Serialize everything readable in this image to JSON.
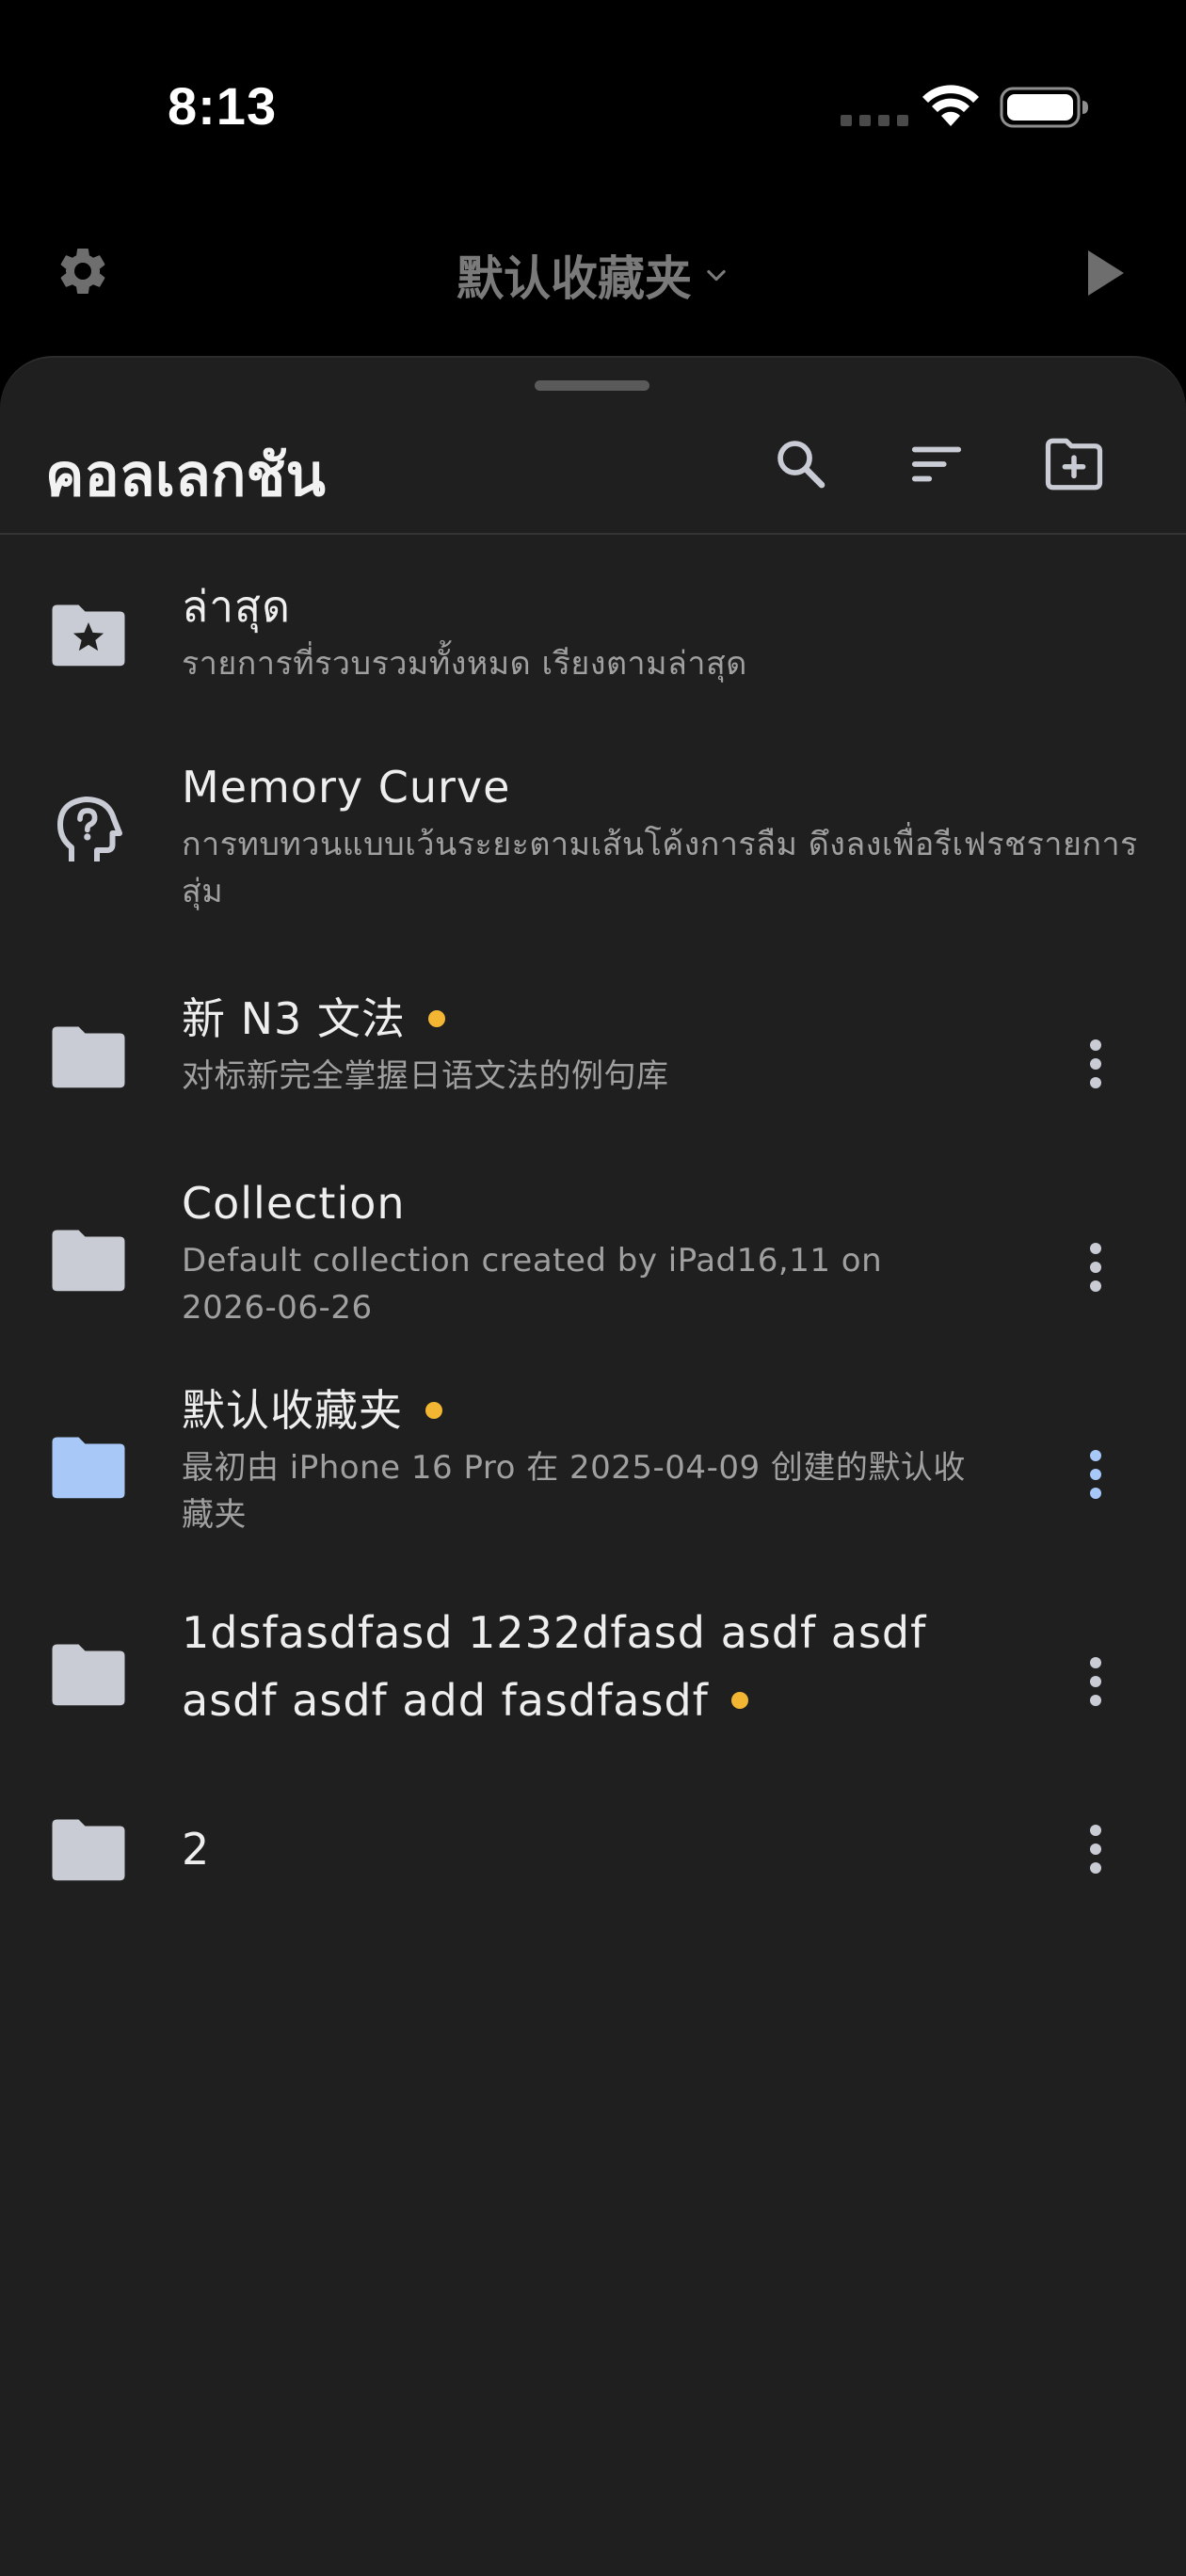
{
  "status_bar": {
    "time": "8:13"
  },
  "top_bar": {
    "current_collection": "默认收藏夹",
    "icons": [
      "gear-icon",
      "chevron-down-icon",
      "play-icon"
    ]
  },
  "sheet": {
    "title": "คอลเลกชัน",
    "header_icons": [
      "search-icon",
      "sort-icon",
      "new-folder-icon"
    ]
  },
  "collections": [
    {
      "title": "ล่าสุด",
      "subtitle": "รายการที่รวบรวมทั้งหมด เรียงตามล่าสุด",
      "icon": "star-folder-icon",
      "badge": false,
      "has_menu": false
    },
    {
      "title": "Memory Curve",
      "subtitle": "การทบทวนแบบเว้นระยะตามเส้นโค้งการลืม ดึงลงเพื่อรีเฟรชรายการสุ่ม",
      "icon": "brain-question-icon",
      "badge": false,
      "has_menu": false
    },
    {
      "title": "新 N3 文法",
      "subtitle": "对标新完全掌握日语文法的例句库",
      "icon": "folder-icon",
      "badge": true,
      "has_menu": true
    },
    {
      "title": "Collection",
      "subtitle": "Default collection created by iPad16,11 on 2026-06-26",
      "icon": "folder-icon",
      "badge": false,
      "has_menu": true
    },
    {
      "title": "默认收藏夹",
      "subtitle": "最初由 iPhone 16 Pro 在 2025-04-09 创建的默认收藏夹",
      "icon": "folder-icon",
      "badge": true,
      "has_menu": true,
      "selected": true
    },
    {
      "title": "1dsfasdfasd 1232dfasd asdf asdf asdf asdf add fasdfasdf",
      "subtitle": "",
      "icon": "folder-icon",
      "badge": true,
      "has_menu": true
    },
    {
      "title": "2",
      "subtitle": "",
      "icon": "folder-icon",
      "badge": false,
      "has_menu": true
    }
  ],
  "colors": {
    "background": "#000000",
    "sheet": "#1f1f1f",
    "accent": "#a8c8f8",
    "badge": "#f2b632",
    "icon_default": "#c9ccd4"
  }
}
